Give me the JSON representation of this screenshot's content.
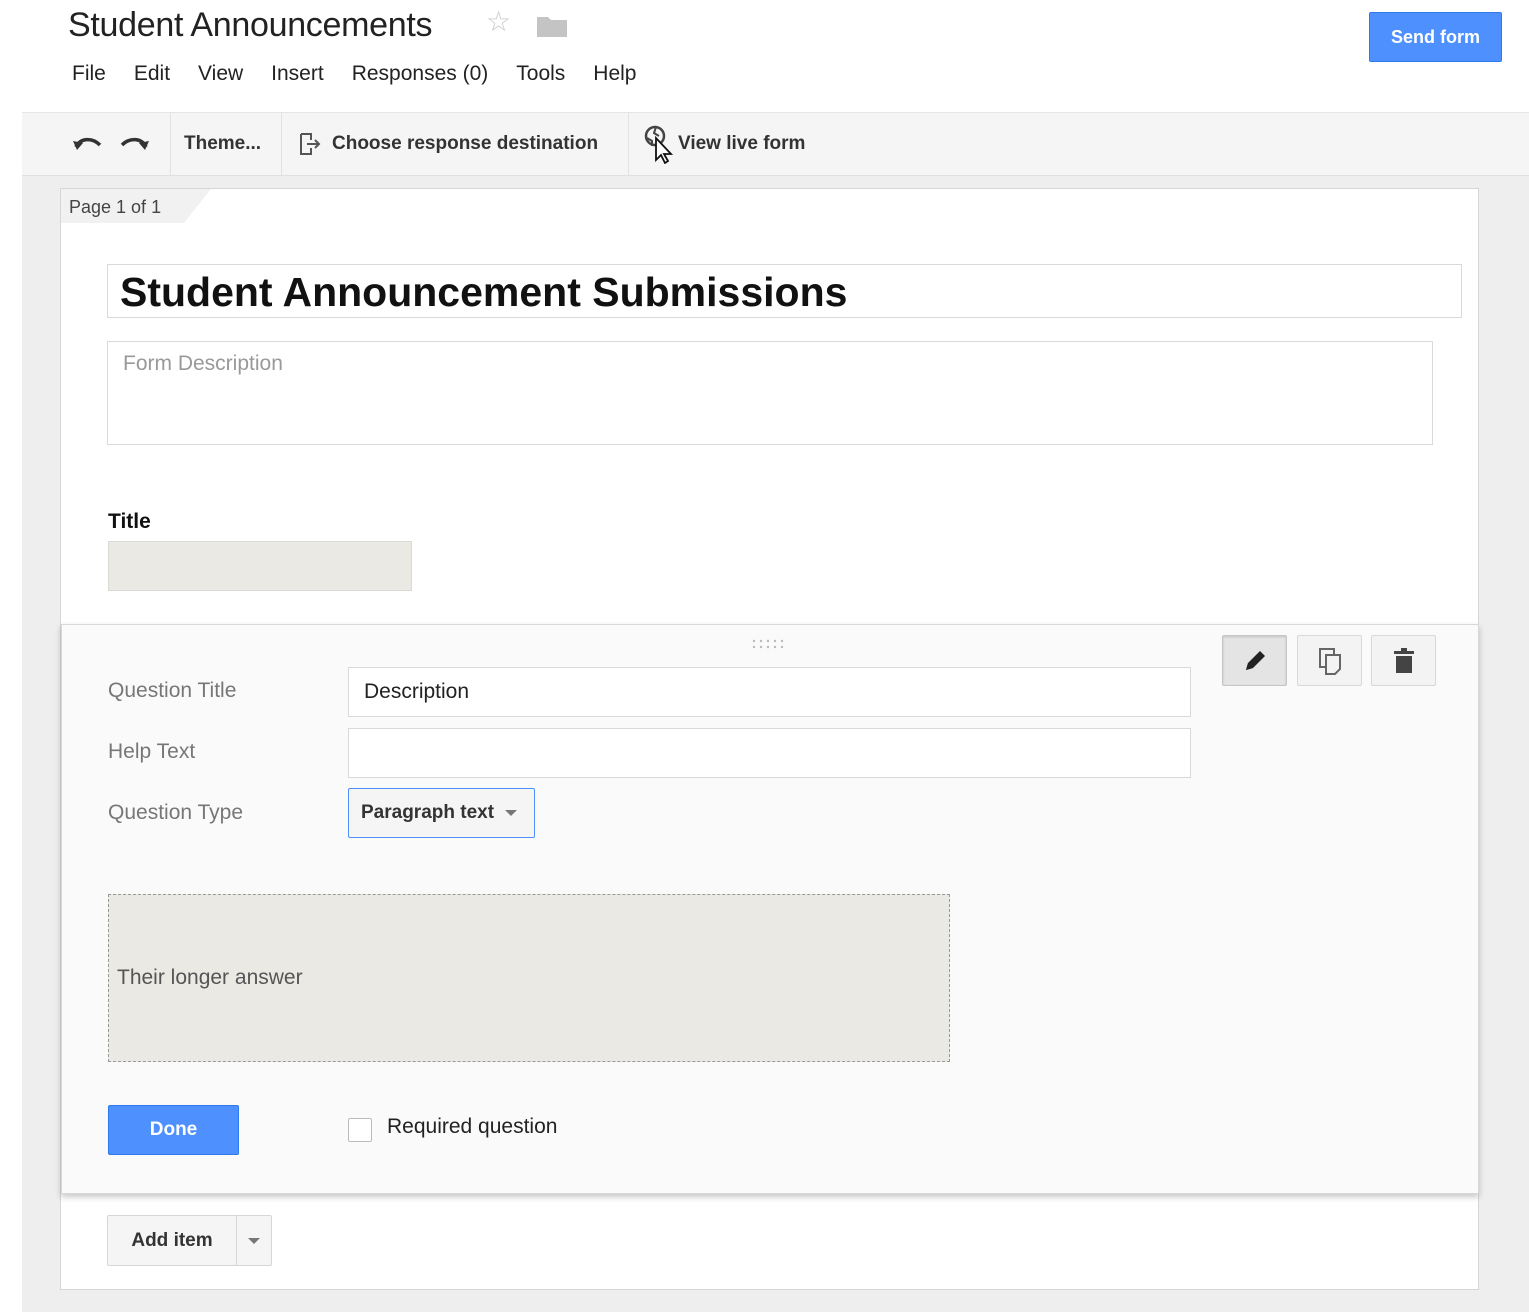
{
  "header": {
    "title": "Student Announcements",
    "send_button": "Send form"
  },
  "menu": [
    "File",
    "Edit",
    "View",
    "Insert",
    "Responses (0)",
    "Tools",
    "Help"
  ],
  "toolbar": {
    "theme": "Theme...",
    "response_destination": "Choose response destination",
    "view_live": "View live form"
  },
  "page_indicator": "Page 1 of 1",
  "form": {
    "title": "Student Announcement Submissions",
    "description_placeholder": "Form Description"
  },
  "question1": {
    "title": "Title"
  },
  "editor": {
    "question_title_label": "Question Title",
    "question_title_value": "Description",
    "help_text_label": "Help Text",
    "help_text_value": "",
    "question_type_label": "Question Type",
    "question_type_value": "Paragraph text",
    "answer_preview": "Their longer answer",
    "done_button": "Done",
    "required_label": "Required question",
    "required_checked": false
  },
  "add_item": "Add item",
  "colors": {
    "primary_button": "#4d90fe",
    "canvas_bg": "#eeeeee",
    "input_fill": "#ebe9e4"
  }
}
